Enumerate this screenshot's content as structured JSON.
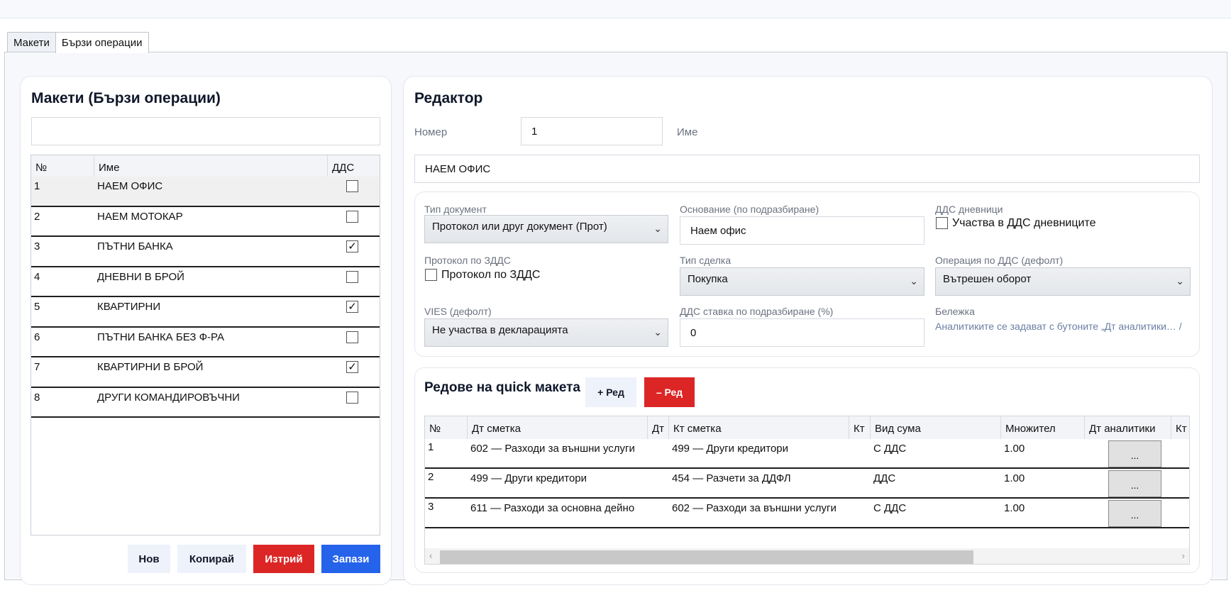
{
  "tabs": [
    "Макети",
    "Бързи операции"
  ],
  "left": {
    "title": "Макети (Бързи операции)",
    "search_value": "",
    "columns": [
      "№",
      "Име",
      "ДДС"
    ],
    "rows": [
      {
        "no": "1",
        "name": "НАЕМ ОФИС",
        "vat": false
      },
      {
        "no": "2",
        "name": "НАЕМ МОТОКАР",
        "vat": false
      },
      {
        "no": "3",
        "name": "ПЪТНИ БАНКА",
        "vat": true
      },
      {
        "no": "4",
        "name": "ДНЕВНИ В БРОЙ",
        "vat": false
      },
      {
        "no": "5",
        "name": "КВАРТИРНИ",
        "vat": true
      },
      {
        "no": "6",
        "name": "ПЪТНИ БАНКА БЕЗ Ф-РА",
        "vat": false
      },
      {
        "no": "7",
        "name": "КВАРТИРНИ В БРОЙ",
        "vat": true
      },
      {
        "no": "8",
        "name": "ДРУГИ КОМАНДИРОВЪЧНИ",
        "vat": false
      }
    ],
    "buttons": {
      "new": "Нов",
      "copy": "Копирай",
      "delete": "Изтрий",
      "save": "Запази"
    }
  },
  "editor": {
    "title": "Редактор",
    "number_label": "Номер",
    "number_value": "1",
    "name_label": "Име",
    "name_value": "НАЕМ ОФИС",
    "doc_type_label": "Тип документ",
    "doc_type_value": "Протокол или друг документ (Прот)",
    "basis_label": "Основание (по подразбиране)",
    "basis_value": "Наем офис",
    "vat_journals_label": "ДДС дневници",
    "vat_journals_check": "Участва в ДДС дневниците",
    "protocol_label": "Протокол по ЗДДС",
    "protocol_check": "Протокол по ЗДДС",
    "deal_type_label": "Тип сделка",
    "deal_type_value": "Покупка",
    "vat_op_label": "Операция по ДДС (дефолт)",
    "vat_op_value": "Вътрешен оборот",
    "vies_label": "VIES (дефолт)",
    "vies_value": "Не участва в декларацията",
    "vat_rate_label": "ДДС ставка по подразбиране (%)",
    "vat_rate_value": "0",
    "note_label": "Бележка",
    "note_text": "Аналитиките се задават с бутоните „Дт аналитики… /"
  },
  "rows_section": {
    "title": "Редове на quick макета",
    "add_label": "+ Ред",
    "remove_label": "– Ред",
    "columns": [
      "№",
      "Дт сметка",
      "Дт",
      "Кт сметка",
      "Кт",
      "Вид сума",
      "Множител",
      "Дт аналитики",
      "Кт"
    ],
    "rows": [
      {
        "no": "1",
        "dt": "602 — Разходи за външни услуги",
        "kt": "499 — Други кредитори",
        "kind": "С ДДС",
        "mult": "1.00",
        "dots": "..."
      },
      {
        "no": "2",
        "dt": "499 — Други кредитори",
        "kt": "454 — Разчети за ДДФЛ",
        "kind": "ДДС",
        "mult": "1.00",
        "dots": "..."
      },
      {
        "no": "3",
        "dt": "611 — Разходи за основна дейно",
        "kt": "602 — Разходи за външни услуги",
        "kind": "С ДДС",
        "mult": "1.00",
        "dots": "..."
      }
    ]
  }
}
